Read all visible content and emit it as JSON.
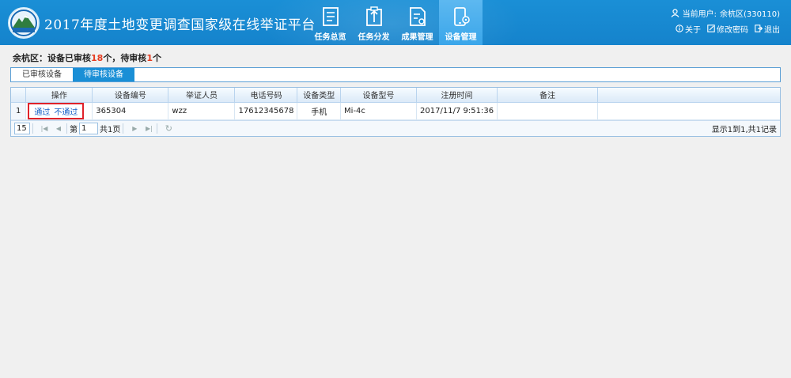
{
  "header": {
    "title": "2017年度土地变更调查国家级在线举证平台",
    "nav": [
      {
        "label": "任务总览",
        "icon": "task-overview-icon"
      },
      {
        "label": "任务分发",
        "icon": "task-dispatch-icon"
      },
      {
        "label": "成果管理",
        "icon": "result-management-icon"
      },
      {
        "label": "设备管理",
        "icon": "device-management-icon",
        "active": true
      }
    ],
    "user": {
      "label": "当前用户:",
      "name": "余杭区(330110)"
    },
    "links": {
      "about": "关于",
      "change_password": "修改密码",
      "logout": "退出"
    }
  },
  "summary": {
    "district": "余杭区：",
    "reviewed_prefix": "设备已审核",
    "reviewed_count": "18",
    "reviewed_suffix": "个，",
    "pending_prefix": "待审核",
    "pending_count": "1",
    "pending_suffix": "个"
  },
  "tabs": [
    {
      "label": "已审核设备",
      "active": false
    },
    {
      "label": "待审核设备",
      "active": true
    }
  ],
  "table": {
    "columns": [
      "操作",
      "设备编号",
      "举证人员",
      "电话号码",
      "设备类型",
      "设备型号",
      "注册时间",
      "备注"
    ],
    "rows": [
      {
        "index": "1",
        "actions": [
          "通过",
          "不通过"
        ],
        "device_no": "365304",
        "person": "wzz",
        "phone": "17612345678",
        "device_type": "手机",
        "model": "Mi-4c",
        "reg_time": "2017/11/7 9:51:36",
        "note": ""
      }
    ]
  },
  "pager": {
    "page_size": "15",
    "page_prefix": "第",
    "page_value": "1",
    "page_total": "共1页",
    "info": "显示1到1,共1记录"
  },
  "colors": {
    "header_bg": "#1a8fd6",
    "active_tab": "#1a8fd6",
    "highlight_box": "#e0222a",
    "count_red": "#e53b1f"
  }
}
